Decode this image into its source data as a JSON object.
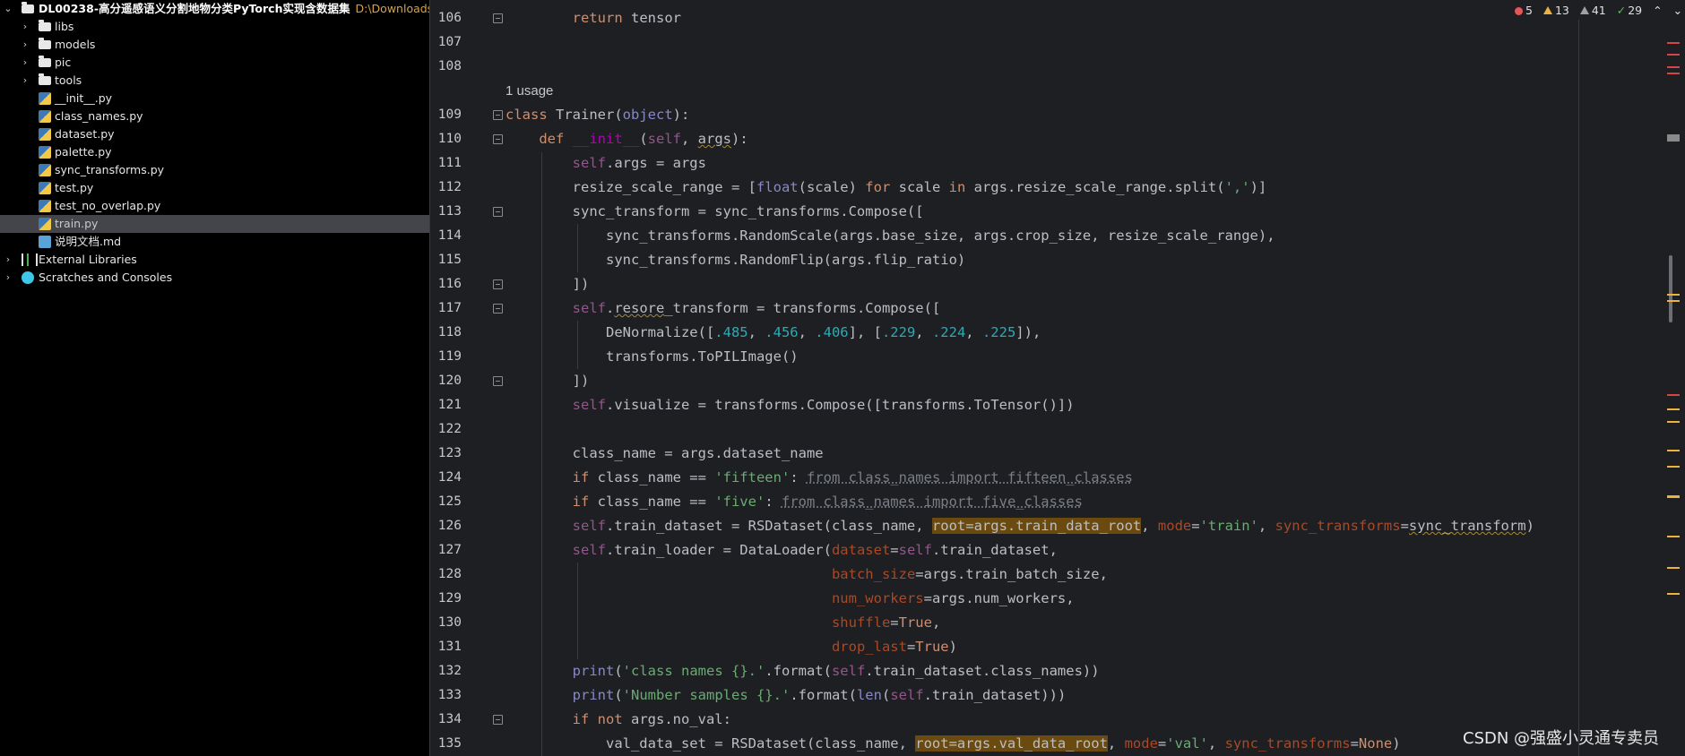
{
  "project": {
    "title": "DL00238-高分遥感语义分割地物分类PyTorch实现含数据集",
    "path": "D:\\Downloads\\Hig",
    "folders": [
      {
        "name": "libs",
        "icon": "folder-icon"
      },
      {
        "name": "models",
        "icon": "folder-icon"
      },
      {
        "name": "pic",
        "icon": "folder-icon"
      },
      {
        "name": "tools",
        "icon": "folder-icon"
      }
    ],
    "files": [
      {
        "name": "__init__.py",
        "icon": "python-file-icon"
      },
      {
        "name": "class_names.py",
        "icon": "python-file-icon"
      },
      {
        "name": "dataset.py",
        "icon": "python-file-icon"
      },
      {
        "name": "palette.py",
        "icon": "python-file-icon"
      },
      {
        "name": "sync_transforms.py",
        "icon": "python-file-icon"
      },
      {
        "name": "test.py",
        "icon": "python-file-icon"
      },
      {
        "name": "test_no_overlap.py",
        "icon": "python-file-icon"
      },
      {
        "name": "train.py",
        "icon": "python-file-icon"
      },
      {
        "name": "说明文档.md",
        "icon": "markdown-file-icon"
      }
    ],
    "external_libraries": "External Libraries",
    "scratches": "Scratches and Consoles",
    "selected_file": "train.py"
  },
  "inspections": {
    "errors": "5",
    "warnings": "13",
    "weak_warnings": "41",
    "typos": "29"
  },
  "editor": {
    "usage_hint": "1 usage",
    "line_numbers": [
      "106",
      "107",
      "108",
      "109",
      "110",
      "111",
      "112",
      "113",
      "114",
      "115",
      "116",
      "117",
      "118",
      "119",
      "120",
      "121",
      "122",
      "123",
      "124",
      "125",
      "126",
      "127",
      "128",
      "129",
      "130",
      "131",
      "132",
      "133",
      "134",
      "135"
    ]
  },
  "colors": {
    "keyword": "#cf8e6d",
    "self": "#94558d",
    "string": "#6aab73",
    "number": "#2aacb8",
    "named_param": "#aa4926",
    "highlight": "#6b4a10"
  },
  "watermark": "CSDN @强盛小灵通专卖员"
}
